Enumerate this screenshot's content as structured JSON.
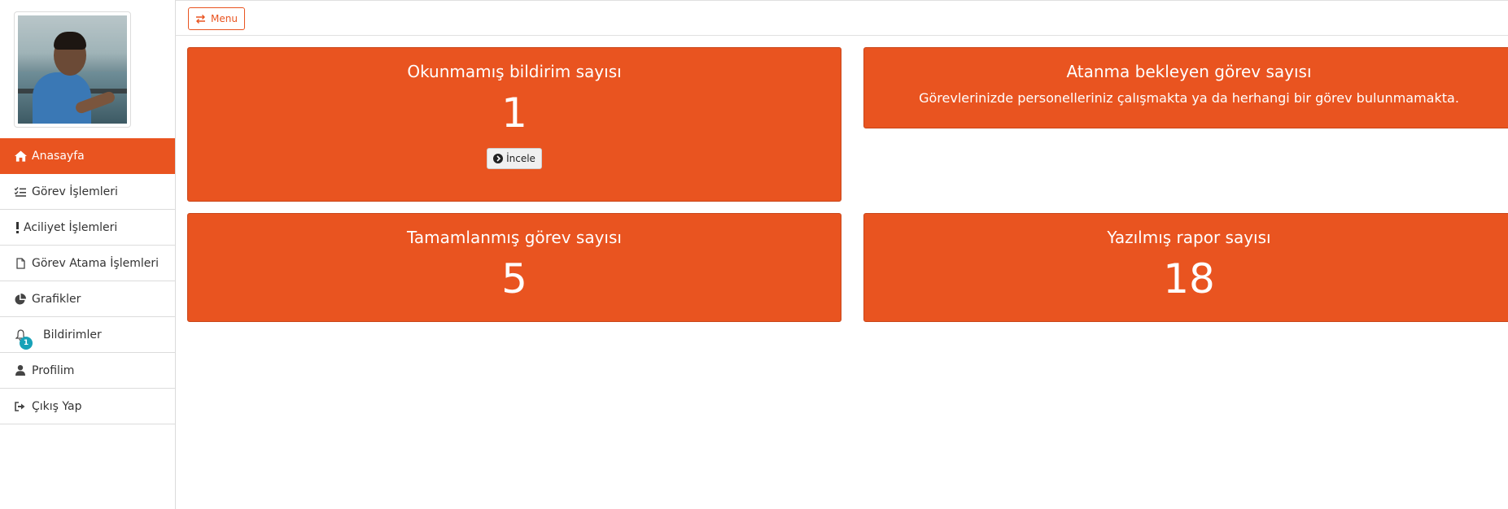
{
  "sidebar": {
    "items": [
      {
        "label": "Anasayfa",
        "icon": "home-icon",
        "active": true
      },
      {
        "label": "Görev İşlemleri",
        "icon": "tasks-icon"
      },
      {
        "label": "Aciliyet İşlemleri",
        "icon": "exclamation-icon"
      },
      {
        "label": "Görev Atama İşlemleri",
        "icon": "file-icon"
      },
      {
        "label": "Grafikler",
        "icon": "pie-chart-icon"
      },
      {
        "label": "Bildirimler",
        "icon": "bell-icon",
        "badge": "1"
      },
      {
        "label": "Profilim",
        "icon": "user-icon"
      },
      {
        "label": "Çıkış Yap",
        "icon": "sign-out-icon"
      }
    ]
  },
  "topbar": {
    "menu_label": "Menu"
  },
  "cards": {
    "unread": {
      "title": "Okunmamış bildirim sayısı",
      "value": "1",
      "button_label": "İncele"
    },
    "awaiting": {
      "title": "Atanma bekleyen görev sayısı",
      "note": "Görevlerinizde personelleriniz çalışmakta ya da herhangi bir görev bulunmamakta."
    },
    "completed": {
      "title": "Tamamlanmış görev sayısı",
      "value": "5"
    },
    "reports": {
      "title": "Yazılmış rapor sayısı",
      "value": "18"
    }
  },
  "colors": {
    "accent": "#e95420",
    "badge": "#17a2b8"
  }
}
